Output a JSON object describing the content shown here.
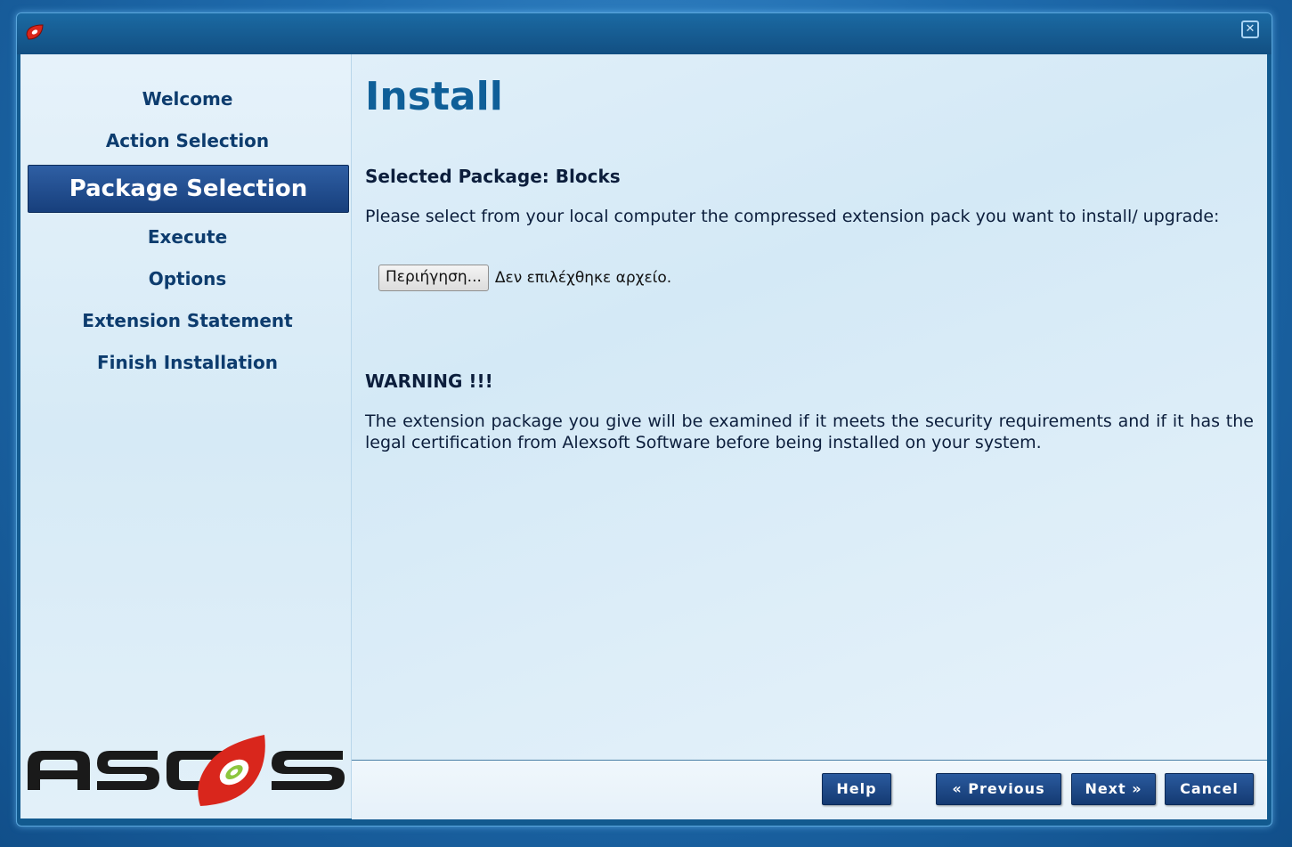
{
  "window": {
    "close_symbol": "✕"
  },
  "sidebar": {
    "items": [
      {
        "label": "Welcome"
      },
      {
        "label": "Action Selection"
      },
      {
        "label": "Package Selection"
      },
      {
        "label": "Execute"
      },
      {
        "label": "Options"
      },
      {
        "label": "Extension Statement"
      },
      {
        "label": "Finish Installation"
      }
    ],
    "active_index": 2,
    "logo_text": "ASCOS"
  },
  "main": {
    "title": "Install",
    "selected_package": "Selected Package: Blocks",
    "instruction": "Please select from your local computer the compressed extension pack you want to install/ upgrade:",
    "file_input": {
      "button_label": "Περιήγηση...",
      "status": "Δεν επιλέχθηκε αρχείο."
    },
    "warning_title": "WARNING !!!",
    "warning_text": "The extension package you give will be examined if it meets the security requirements and if it has the legal certification from Alexsoft Software before being installed on your system."
  },
  "footer": {
    "help": "Help",
    "previous": "« Previous",
    "next": "Next »",
    "cancel": "Cancel"
  },
  "colors": {
    "accent": "#0f5f98",
    "nav_active_bg": "#1f4c8e",
    "button_bg": "#1e4a88",
    "logo_red": "#d9261c",
    "logo_green": "#8cc63f"
  }
}
